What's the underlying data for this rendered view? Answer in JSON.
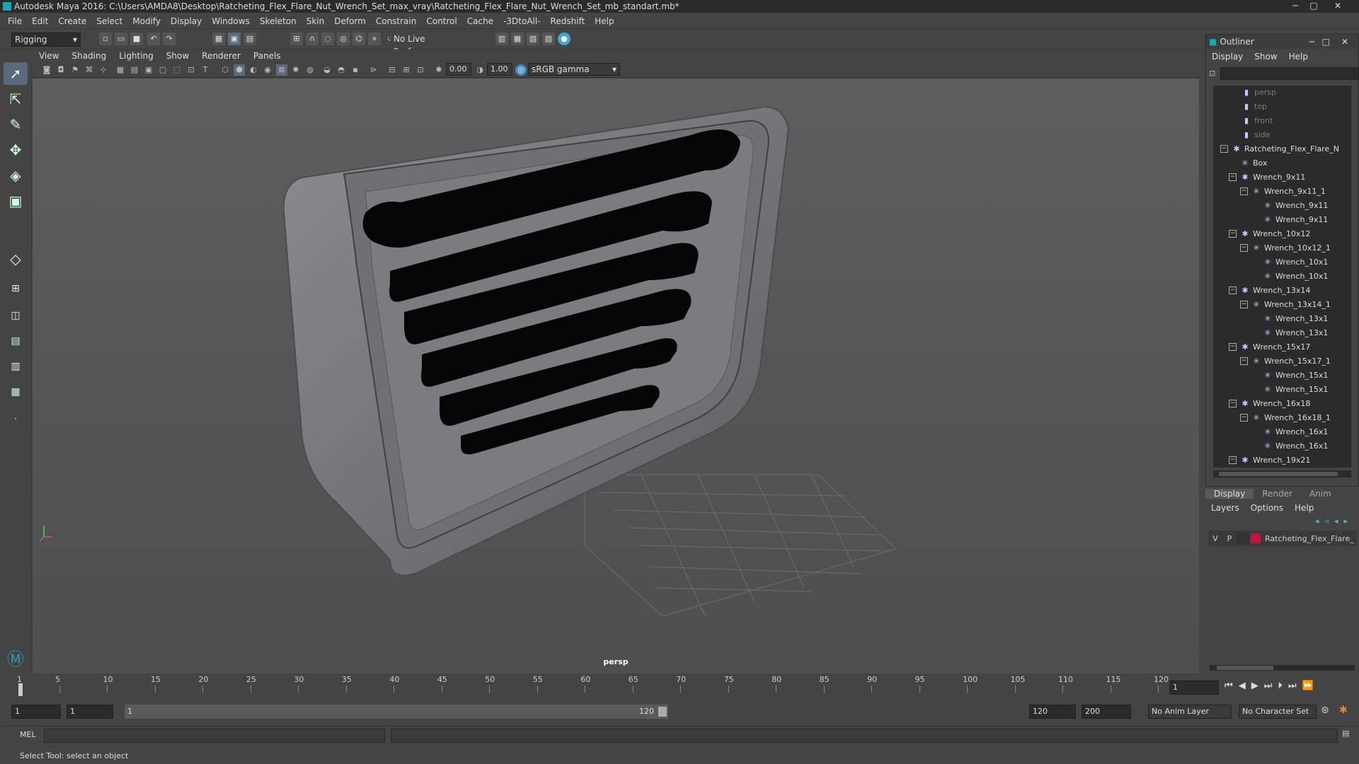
{
  "window": {
    "title": "Autodesk Maya 2016: C:\\Users\\AMDA8\\Desktop\\Ratcheting_Flex_Flare_Nut_Wrench_Set_max_vray\\Ratcheting_Flex_Flare_Nut_Wrench_Set_mb_standart.mb*",
    "min": "─",
    "max": "□",
    "close": "✕"
  },
  "menubar": [
    "File",
    "Edit",
    "Create",
    "Select",
    "Modify",
    "Display",
    "Windows",
    "Skeleton",
    "Skin",
    "Deform",
    "Constrain",
    "Control",
    "Cache",
    "-3DtoAll-",
    "Redshift",
    "Help"
  ],
  "shelf": {
    "mode": "Rigging",
    "live_surface": "No Live Surface"
  },
  "panel": {
    "menus": [
      "View",
      "Shading",
      "Lighting",
      "Show",
      "Renderer",
      "Panels"
    ],
    "exposure": "0.00",
    "gamma": "1.00",
    "colorspace": "sRGB gamma",
    "camera": "persp"
  },
  "outliner": {
    "title": "Outliner",
    "menus": [
      "Display",
      "Show",
      "Help"
    ],
    "items": [
      {
        "label": "persp",
        "dim": true
      },
      {
        "label": "top",
        "dim": true
      },
      {
        "label": "front",
        "dim": true
      },
      {
        "label": "side",
        "dim": true
      },
      {
        "label": "Ratcheting_Flex_Flare_N"
      },
      {
        "label": "Box"
      },
      {
        "label": "Wrench_9x11"
      },
      {
        "label": "Wrench_9x11_1"
      },
      {
        "label": "Wrench_9x11"
      },
      {
        "label": "Wrench_9x11"
      },
      {
        "label": "Wrench_10x12"
      },
      {
        "label": "Wrench_10x12_1"
      },
      {
        "label": "Wrench_10x1"
      },
      {
        "label": "Wrench_10x1"
      },
      {
        "label": "Wrench_13x14"
      },
      {
        "label": "Wrench_13x14_1"
      },
      {
        "label": "Wrench_13x1"
      },
      {
        "label": "Wrench_13x1"
      },
      {
        "label": "Wrench_15x17"
      },
      {
        "label": "Wrench_15x17_1"
      },
      {
        "label": "Wrench_15x1"
      },
      {
        "label": "Wrench_15x1"
      },
      {
        "label": "Wrench_16x18"
      },
      {
        "label": "Wrench_16x18_1"
      },
      {
        "label": "Wrench_16x1"
      },
      {
        "label": "Wrench_16x1"
      },
      {
        "label": "Wrench_19x21"
      }
    ]
  },
  "layers": {
    "tabs": [
      "Display",
      "Render",
      "Anim"
    ],
    "menus": [
      "Layers",
      "Options",
      "Help"
    ],
    "row": {
      "v": "V",
      "p": "P",
      "name": "Ratcheting_Flex_Flare_",
      "color": "#c0143c"
    }
  },
  "timeline": {
    "ticks": [
      "1",
      "5",
      "10",
      "15",
      "20",
      "25",
      "30",
      "35",
      "40",
      "45",
      "50",
      "55",
      "60",
      "65",
      "70",
      "75",
      "80",
      "85",
      "90",
      "95",
      "100",
      "105",
      "110",
      "115",
      "120"
    ],
    "current_frame": "1"
  },
  "range": {
    "start": "1",
    "start2": "1",
    "range_start": "1",
    "range_end": "120",
    "end": "120",
    "end2": "200",
    "anim_layer": "No Anim Layer",
    "char_set": "No Character Set"
  },
  "cmd": {
    "label": "MEL"
  },
  "help": {
    "text": "Select Tool: select an object"
  }
}
